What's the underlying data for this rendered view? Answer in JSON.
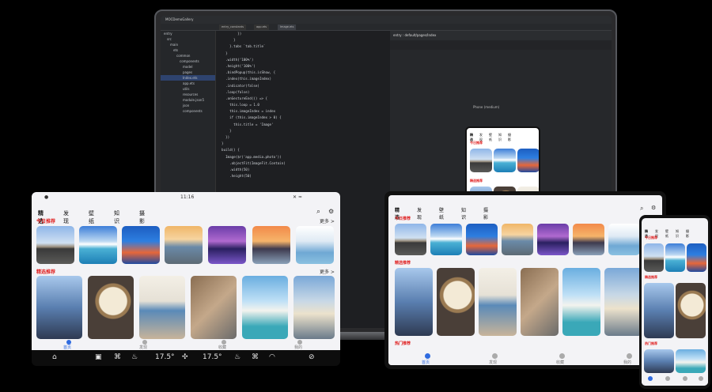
{
  "ide": {
    "window_title": "MOCDemoGallery",
    "tabs": [
      "entry_constants",
      "app.ets",
      "Image.ets"
    ],
    "tree": [
      "entry",
      "src",
      "main",
      "ets",
      "common",
      "components",
      "model",
      "pages",
      "Index.ets",
      "app.ets",
      "utils",
      "resources",
      "module.json5",
      "json",
      "components"
    ],
    "code_lines": [
      "          })",
      "        }",
      "      }.tabs `tab.title`",
      "    }",
      "    .width('100%')",
      "    .height('100%')",
      "    .bindPopup(this.isShow, {",
      "    .index(this.imageIndex)",
      "    .indicator(false)",
      "    .loop(false)",
      "    .onGestureEnd(() => {",
      "      this.loop = 1.0",
      "      this.imageIndex = index",
      "      if (this.imageIndex > 0) {",
      "        this.title = 'Image'",
      "      }",
      "    })",
      "  }",
      "  build() {",
      "    Image($r('app.media.photo'))",
      "      .objectFit(ImageFit.Contain)",
      "      .width(50)",
      "      .height(50)"
    ],
    "preview_header": "entry : default/pages/Index",
    "preview_device": "Phone (medium)"
  },
  "app": {
    "tabs": [
      "精选",
      "发现",
      "壁纸",
      "知识",
      "摄影"
    ],
    "today_title": "今日推荐",
    "featured_title": "精选推荐",
    "more_label": "更多 >",
    "hot_title": "热门推荐",
    "nav_items": [
      "首页",
      "发现",
      "收藏",
      "我的"
    ]
  },
  "car": {
    "status_time": "11:16",
    "temp_left": "17.5°",
    "temp_right": "17.5°"
  }
}
